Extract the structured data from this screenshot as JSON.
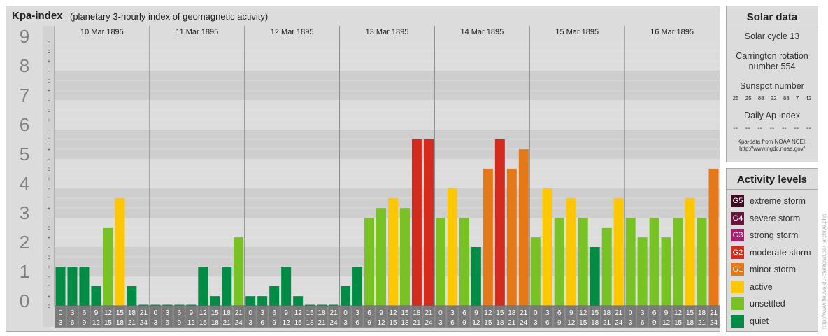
{
  "header": {
    "title": "Kpa-index",
    "subtitle": "(planetary 3-hourly index of geomagnetic activity)"
  },
  "chart_data": {
    "type": "bar",
    "title": "Kpa-index",
    "subtitle": "(planetary 3-hourly index of geomagnetic activity)",
    "ylim": [
      0,
      9
    ],
    "y_ticks": [
      "0",
      "1",
      "2",
      "3",
      "4",
      "5",
      "6",
      "7",
      "8",
      "9"
    ],
    "y_subticks": [
      "+",
      "o",
      "-"
    ],
    "top_subtick": "o",
    "days": [
      "10 Mar 1895",
      "11 Mar 1895",
      "12 Mar 1895",
      "13 Mar 1895",
      "14 Mar 1895",
      "15 Mar 1895",
      "16 Mar 1895"
    ],
    "interval_starts": [
      "0",
      "3",
      "6",
      "9",
      "12",
      "15",
      "18",
      "21"
    ],
    "interval_ends": [
      "3",
      "6",
      "9",
      "12",
      "15",
      "18",
      "21",
      "24"
    ],
    "values": [
      [
        1.33,
        1.33,
        1.33,
        0.67,
        2.67,
        3.67,
        0.67,
        0
      ],
      [
        0,
        0,
        0,
        0,
        1.33,
        0.33,
        1.33,
        2.33
      ],
      [
        0.33,
        0.33,
        0.67,
        1.33,
        0.33,
        0,
        0,
        0
      ],
      [
        0.67,
        1.33,
        3.0,
        3.33,
        3.67,
        3.33,
        5.67,
        5.67
      ],
      [
        3.0,
        4.0,
        3.0,
        2.0,
        4.67,
        5.67,
        4.67,
        5.33
      ],
      [
        2.33,
        4.0,
        3.0,
        3.67,
        3.0,
        2.0,
        2.67,
        3.67
      ],
      [
        3.0,
        2.33,
        3.0,
        2.33,
        3.0,
        3.67,
        3.0,
        4.67
      ]
    ],
    "level_colors": {
      "quiet": "#008c45",
      "unsettled": "#78c224",
      "active": "#ffc700",
      "G1": "#e57817",
      "G2": "#d32b1e",
      "G3": "#b0196e",
      "G4": "#6e1141",
      "G5": "#3d0a22"
    },
    "grid": true
  },
  "solar": {
    "heading": "Solar data",
    "cycle": "Solar cycle 13",
    "carrington_line1": "Carrington rotation",
    "carrington_line2": "number 554",
    "sunspot_heading": "Sunspot number",
    "sunspot_values": [
      "25",
      "25",
      "88",
      "22",
      "88",
      "7",
      "42"
    ],
    "ap_heading": "Daily Ap-index",
    "ap_values": [
      "--",
      "--",
      "--",
      "--",
      "--",
      "--",
      "--"
    ],
    "source_line1": "Kpa-data from NOAA NCEI:",
    "source_line2": "http://www.ngdc.noaa.gov/"
  },
  "activity": {
    "heading": "Activity levels",
    "levels": [
      {
        "code": "G5",
        "label": "extreme storm",
        "color": "#3d0a22"
      },
      {
        "code": "G4",
        "label": "severe storm",
        "color": "#6e1141"
      },
      {
        "code": "G3",
        "label": "strong storm",
        "color": "#b0196e"
      },
      {
        "code": "G2",
        "label": "moderate storm",
        "color": "#d32b1e"
      },
      {
        "code": "G1",
        "label": "minor storm",
        "color": "#e57817"
      },
      {
        "code": "",
        "label": "active",
        "color": "#ffc700"
      },
      {
        "code": "",
        "label": "unsettled",
        "color": "#78c224"
      },
      {
        "code": "",
        "label": "quiet",
        "color": "#008c45"
      }
    ]
  },
  "watermark": "http://www.fleuve-du-pfalzgraf.de/_archive.php"
}
